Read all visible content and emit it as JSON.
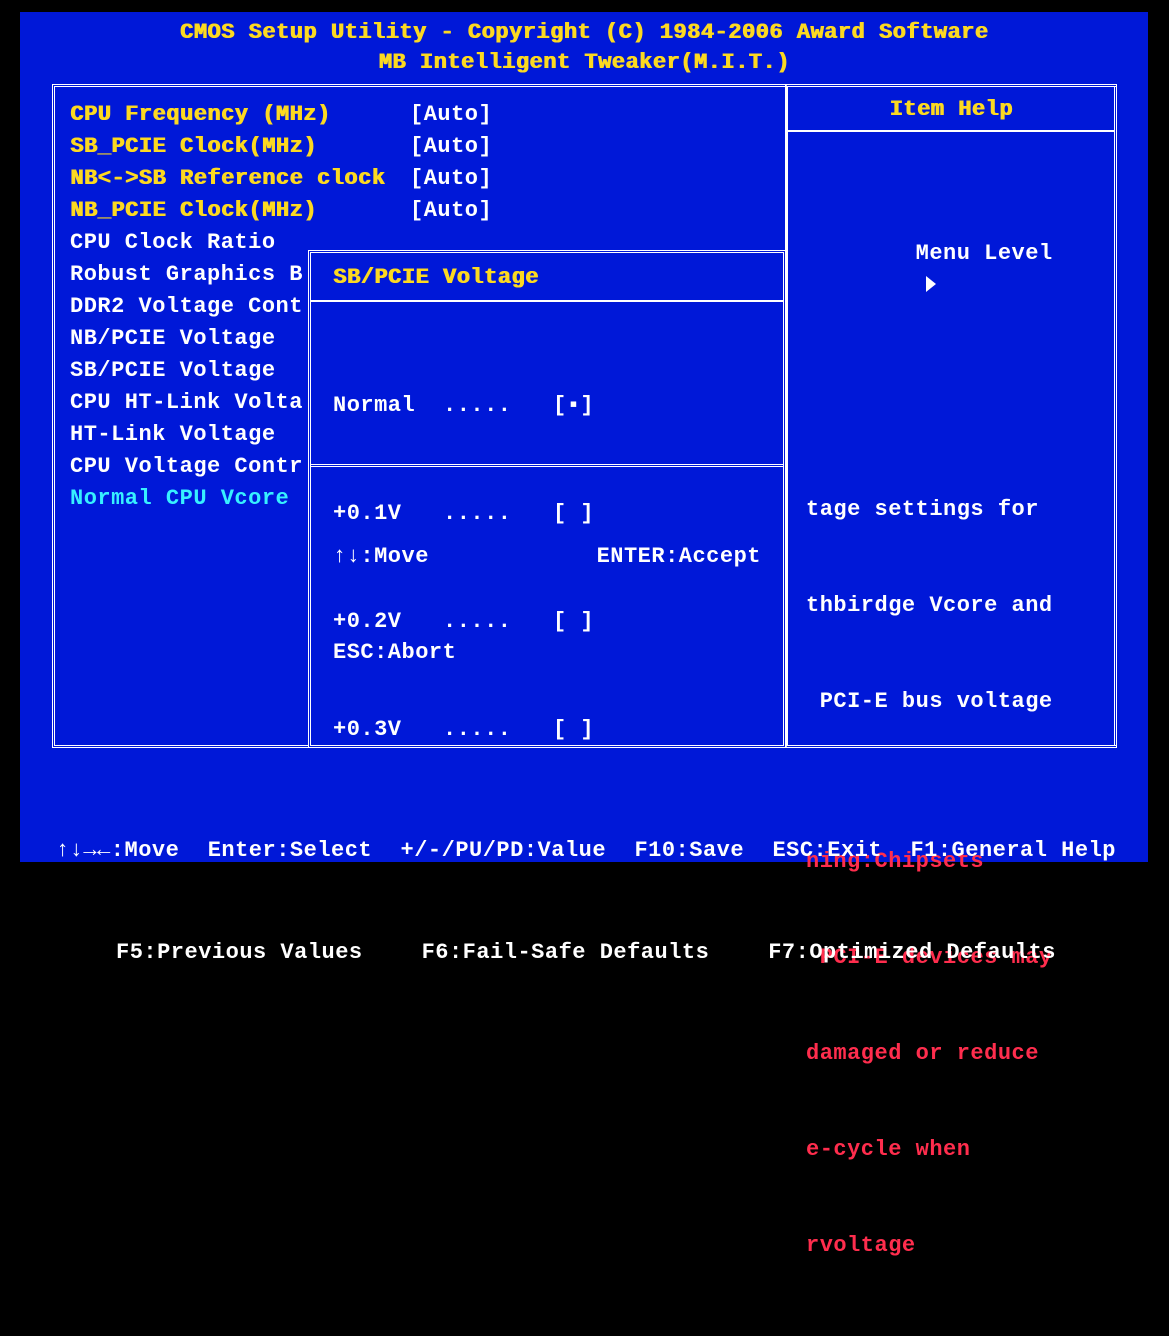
{
  "header": {
    "line1": "CMOS Setup Utility - Copyright (C) 1984-2006 Award Software",
    "line2": "MB Intelligent Tweaker(M.I.T.)"
  },
  "settings": [
    {
      "label": "CPU Frequency (MHz)",
      "value": "[Auto]",
      "yellow_label": true
    },
    {
      "label": "SB_PCIE Clock(MHz)",
      "value": "[Auto]",
      "yellow_label": true
    },
    {
      "label": "NB<->SB Reference clock",
      "value": "[Auto]",
      "yellow_label": true
    },
    {
      "label": "NB_PCIE Clock(MHz)",
      "value": "[Auto]",
      "yellow_label": true
    },
    {
      "label": "CPU Clock Ratio",
      "value": "",
      "yellow_label": false
    },
    {
      "label": "Robust Graphics B",
      "value": "",
      "yellow_label": false
    },
    {
      "label": "DDR2 Voltage Cont",
      "value": "",
      "yellow_label": false
    },
    {
      "label": "NB/PCIE Voltage",
      "value": "",
      "yellow_label": false
    },
    {
      "label": "SB/PCIE Voltage",
      "value": "",
      "yellow_label": false
    },
    {
      "label": "CPU HT-Link Volta",
      "value": "",
      "yellow_label": false
    },
    {
      "label": "HT-Link Voltage",
      "value": "",
      "yellow_label": false
    },
    {
      "label": "CPU Voltage Contr",
      "value": "",
      "yellow_label": false
    },
    {
      "label": "Normal CPU Vcore",
      "value": "",
      "yellow_label": false,
      "cyan": true
    }
  ],
  "help": {
    "title": "Item Help",
    "menu_level": "Menu Level",
    "lines_white": [
      "tage settings for",
      "thbirdge Vcore and",
      " PCI-E bus voltage",
      ""
    ],
    "lines_red": [
      "ning:Chipsets",
      " PCI-E devices may",
      "damaged or reduce",
      "e-cycle when",
      "rvoltage"
    ]
  },
  "popup": {
    "title": "SB/PCIE Voltage",
    "options": [
      {
        "label": "Normal",
        "selected": true
      },
      {
        "label": "+0.1V",
        "selected": false
      },
      {
        "label": "+0.2V",
        "selected": false
      },
      {
        "label": "+0.3V",
        "selected": false
      }
    ],
    "dots": ".....",
    "mark_on": "[▪]",
    "mark_off": "[ ]",
    "footer": {
      "move": "↑↓:Move",
      "accept": "ENTER:Accept",
      "abort": "ESC:Abort"
    }
  },
  "footer": {
    "row1": {
      "a": "↑↓→←:Move",
      "b": "Enter:Select",
      "c": "+/-/PU/PD:Value",
      "d": "F10:Save",
      "e": "ESC:Exit",
      "f": "F1:General Help"
    },
    "row2": {
      "a": "F5:Previous Values",
      "b": "F6:Fail-Safe Defaults",
      "c": "F7:Optimized Defaults"
    }
  }
}
